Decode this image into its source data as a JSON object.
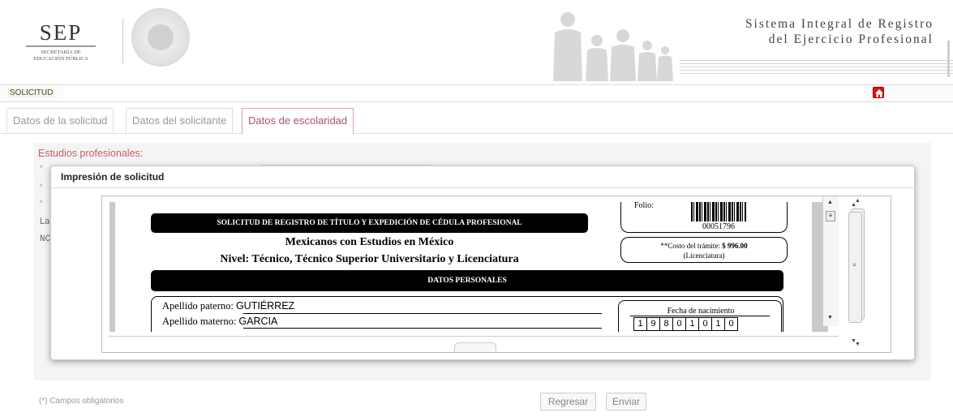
{
  "header": {
    "logo_big": "SEP",
    "logo_line1": "SECRETARÍA DE",
    "logo_line2": "EDUCACIÓN PÚBLICA",
    "title_line1": "Sistema Integral de Registro",
    "title_line2": "del Ejercicio Profesional"
  },
  "topbar": {
    "label": "SOLICITUD",
    "home_icon": "home-icon"
  },
  "tabs": [
    {
      "label": "Datos de la solicitud",
      "active": false
    },
    {
      "label": "Datos del solicitante",
      "active": false
    },
    {
      "label": "Datos de escolaridad",
      "active": true
    }
  ],
  "content": {
    "section_title": "Estudios profesionales:",
    "bullet": "*",
    "partial_la": "La",
    "partial_nc": "NC"
  },
  "modal": {
    "title": "Impresión de solicitud",
    "pdf": {
      "main_title": "SOLICITUD DE REGISTRO DE TÍTULO Y EXPEDICIÓN DE CÉDULA PROFESIONAL",
      "subtitle1": "Mexicanos con Estudios en México",
      "subtitle2": "Nivel: Técnico, Técnico Superior Universitario y Licenciatura",
      "folio_label": "Folio:",
      "folio_number": "00051796",
      "costo_label": "**Costo del trámite:",
      "costo_value": "$ 996.00",
      "costo_note": "(Licenciatura)",
      "section_personal": "DATOS PERSONALES",
      "apellido_paterno_label": "Apellido paterno:",
      "apellido_paterno": "GUTIÉRREZ",
      "apellido_materno_label": "Apellido materno:",
      "apellido_materno": "GARCIA",
      "fecha_label": "Fecha de nacimiento",
      "fecha_digits": [
        "1",
        "9",
        "8",
        "0",
        "1",
        "0",
        "1",
        "0"
      ]
    }
  },
  "footer": {
    "required_note": "(*) Campos obligatorios",
    "back_button": "Regresar",
    "send_button": "Enviar"
  }
}
